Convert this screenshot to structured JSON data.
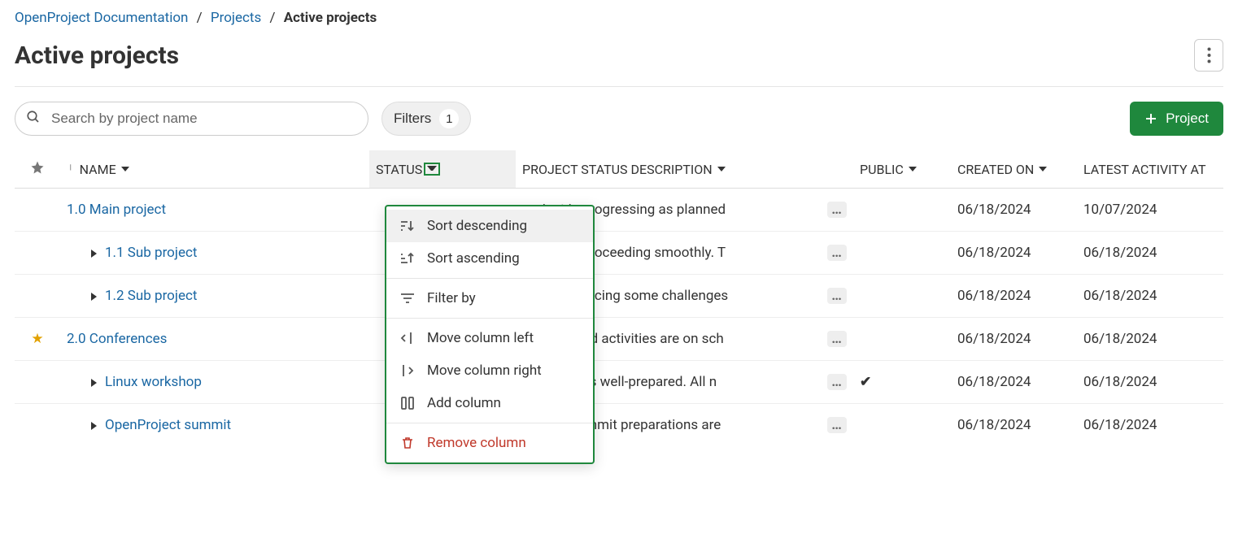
{
  "breadcrumb": {
    "root": "OpenProject Documentation",
    "level1": "Projects",
    "current": "Active projects"
  },
  "page_title": "Active projects",
  "search": {
    "placeholder": "Search by project name"
  },
  "filters": {
    "label": "Filters",
    "count": "1"
  },
  "new_project_label": "Project",
  "columns": {
    "name": "NAME",
    "status": "STATUS",
    "desc": "PROJECT STATUS DESCRIPTION",
    "public": "PUBLIC",
    "created": "CREATED ON",
    "activity": "LATEST ACTIVITY AT"
  },
  "dropdown": {
    "sort_desc": "Sort descending",
    "sort_asc": "Sort ascending",
    "filter_by": "Filter by",
    "move_left": "Move column left",
    "move_right": "Move column right",
    "add_col": "Add column",
    "remove_col": "Remove column"
  },
  "rows": [
    {
      "fav": false,
      "indent": 0,
      "expandable": false,
      "name": "1.0 Main project",
      "desc": "project is progressing as planned",
      "public": "",
      "created": "06/18/2024",
      "activity": "10/07/2024"
    },
    {
      "fav": false,
      "indent": 1,
      "expandable": true,
      "name": "1.1 Sub project",
      "desc": "project is proceeding smoothly. T",
      "public": "",
      "created": "06/18/2024",
      "activity": "06/18/2024"
    },
    {
      "fav": false,
      "indent": 1,
      "expandable": true,
      "name": "1.2 Sub project",
      "desc": "project is facing some challenges",
      "public": "",
      "created": "06/18/2024",
      "activity": "06/18/2024"
    },
    {
      "fav": true,
      "indent": 0,
      "expandable": false,
      "name": "2.0 Conferences",
      "desc": "ence-related activities are on sch",
      "public": "",
      "created": "06/18/2024",
      "activity": "06/18/2024"
    },
    {
      "fav": false,
      "indent": 1,
      "expandable": true,
      "name": "Linux workshop",
      "desc": "workshop is well-prepared. All n",
      "public": "✔",
      "created": "06/18/2024",
      "activity": "06/18/2024"
    },
    {
      "fav": false,
      "indent": 1,
      "expandable": true,
      "name": "OpenProject summit",
      "desc": "Project Summit preparations are",
      "public": "",
      "created": "06/18/2024",
      "activity": "06/18/2024"
    }
  ]
}
